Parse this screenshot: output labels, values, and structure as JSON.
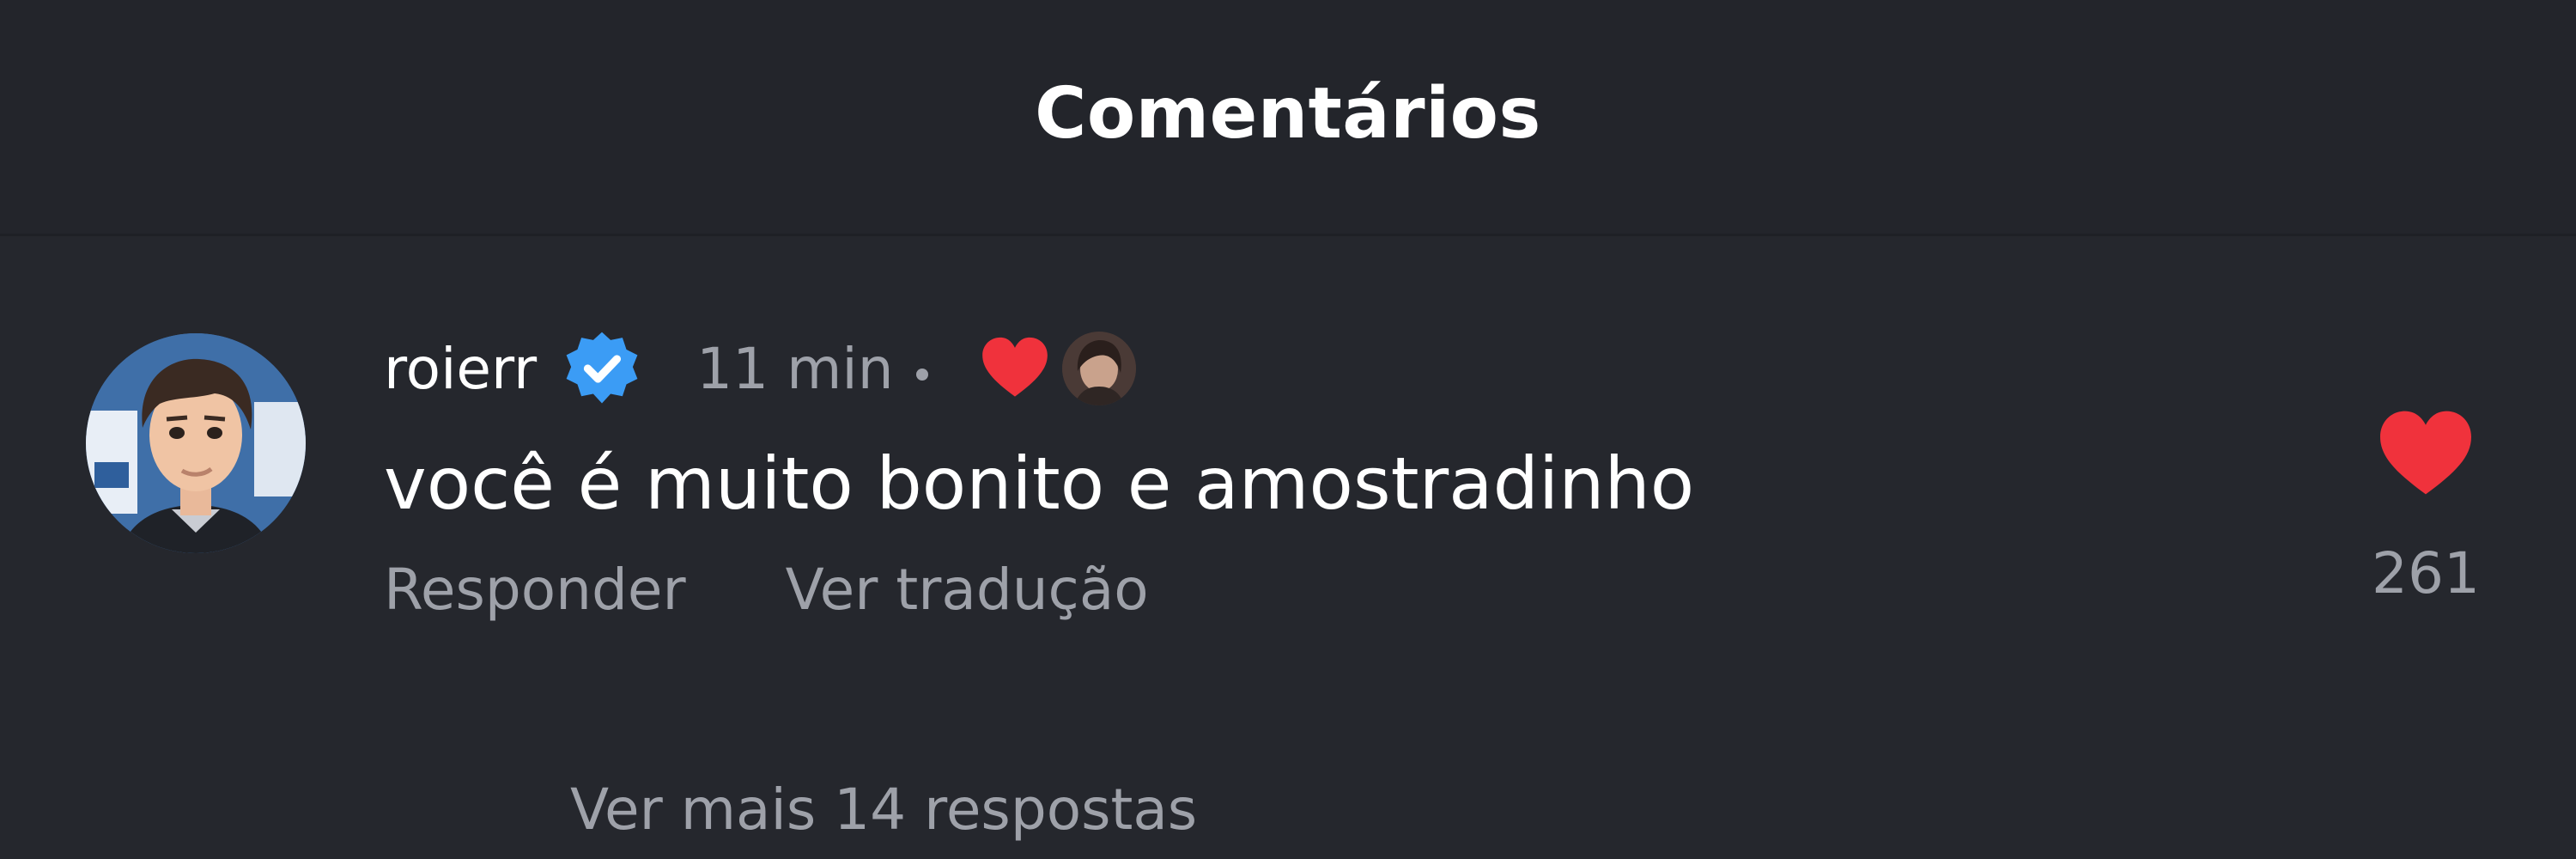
{
  "header": {
    "title": "Comentários"
  },
  "comment": {
    "username": "roierr",
    "verified": true,
    "time": "11 min",
    "liked_by_creator": true,
    "text": "você é muito bonito e amostradinho",
    "actions": {
      "reply": "Responder",
      "translate": "Ver tradução"
    },
    "likes": "261",
    "more_replies": "Ver mais 14 respostas"
  },
  "colors": {
    "background": "#25272d",
    "header_background": "#23252b",
    "text_primary": "#ffffff",
    "text_secondary": "#9ea1a9",
    "heart": "#f0323c",
    "verified": "#3b9cf5"
  },
  "icons": {
    "verified": "verified-badge-icon",
    "creator_heart": "heart-icon",
    "like": "heart-icon"
  }
}
